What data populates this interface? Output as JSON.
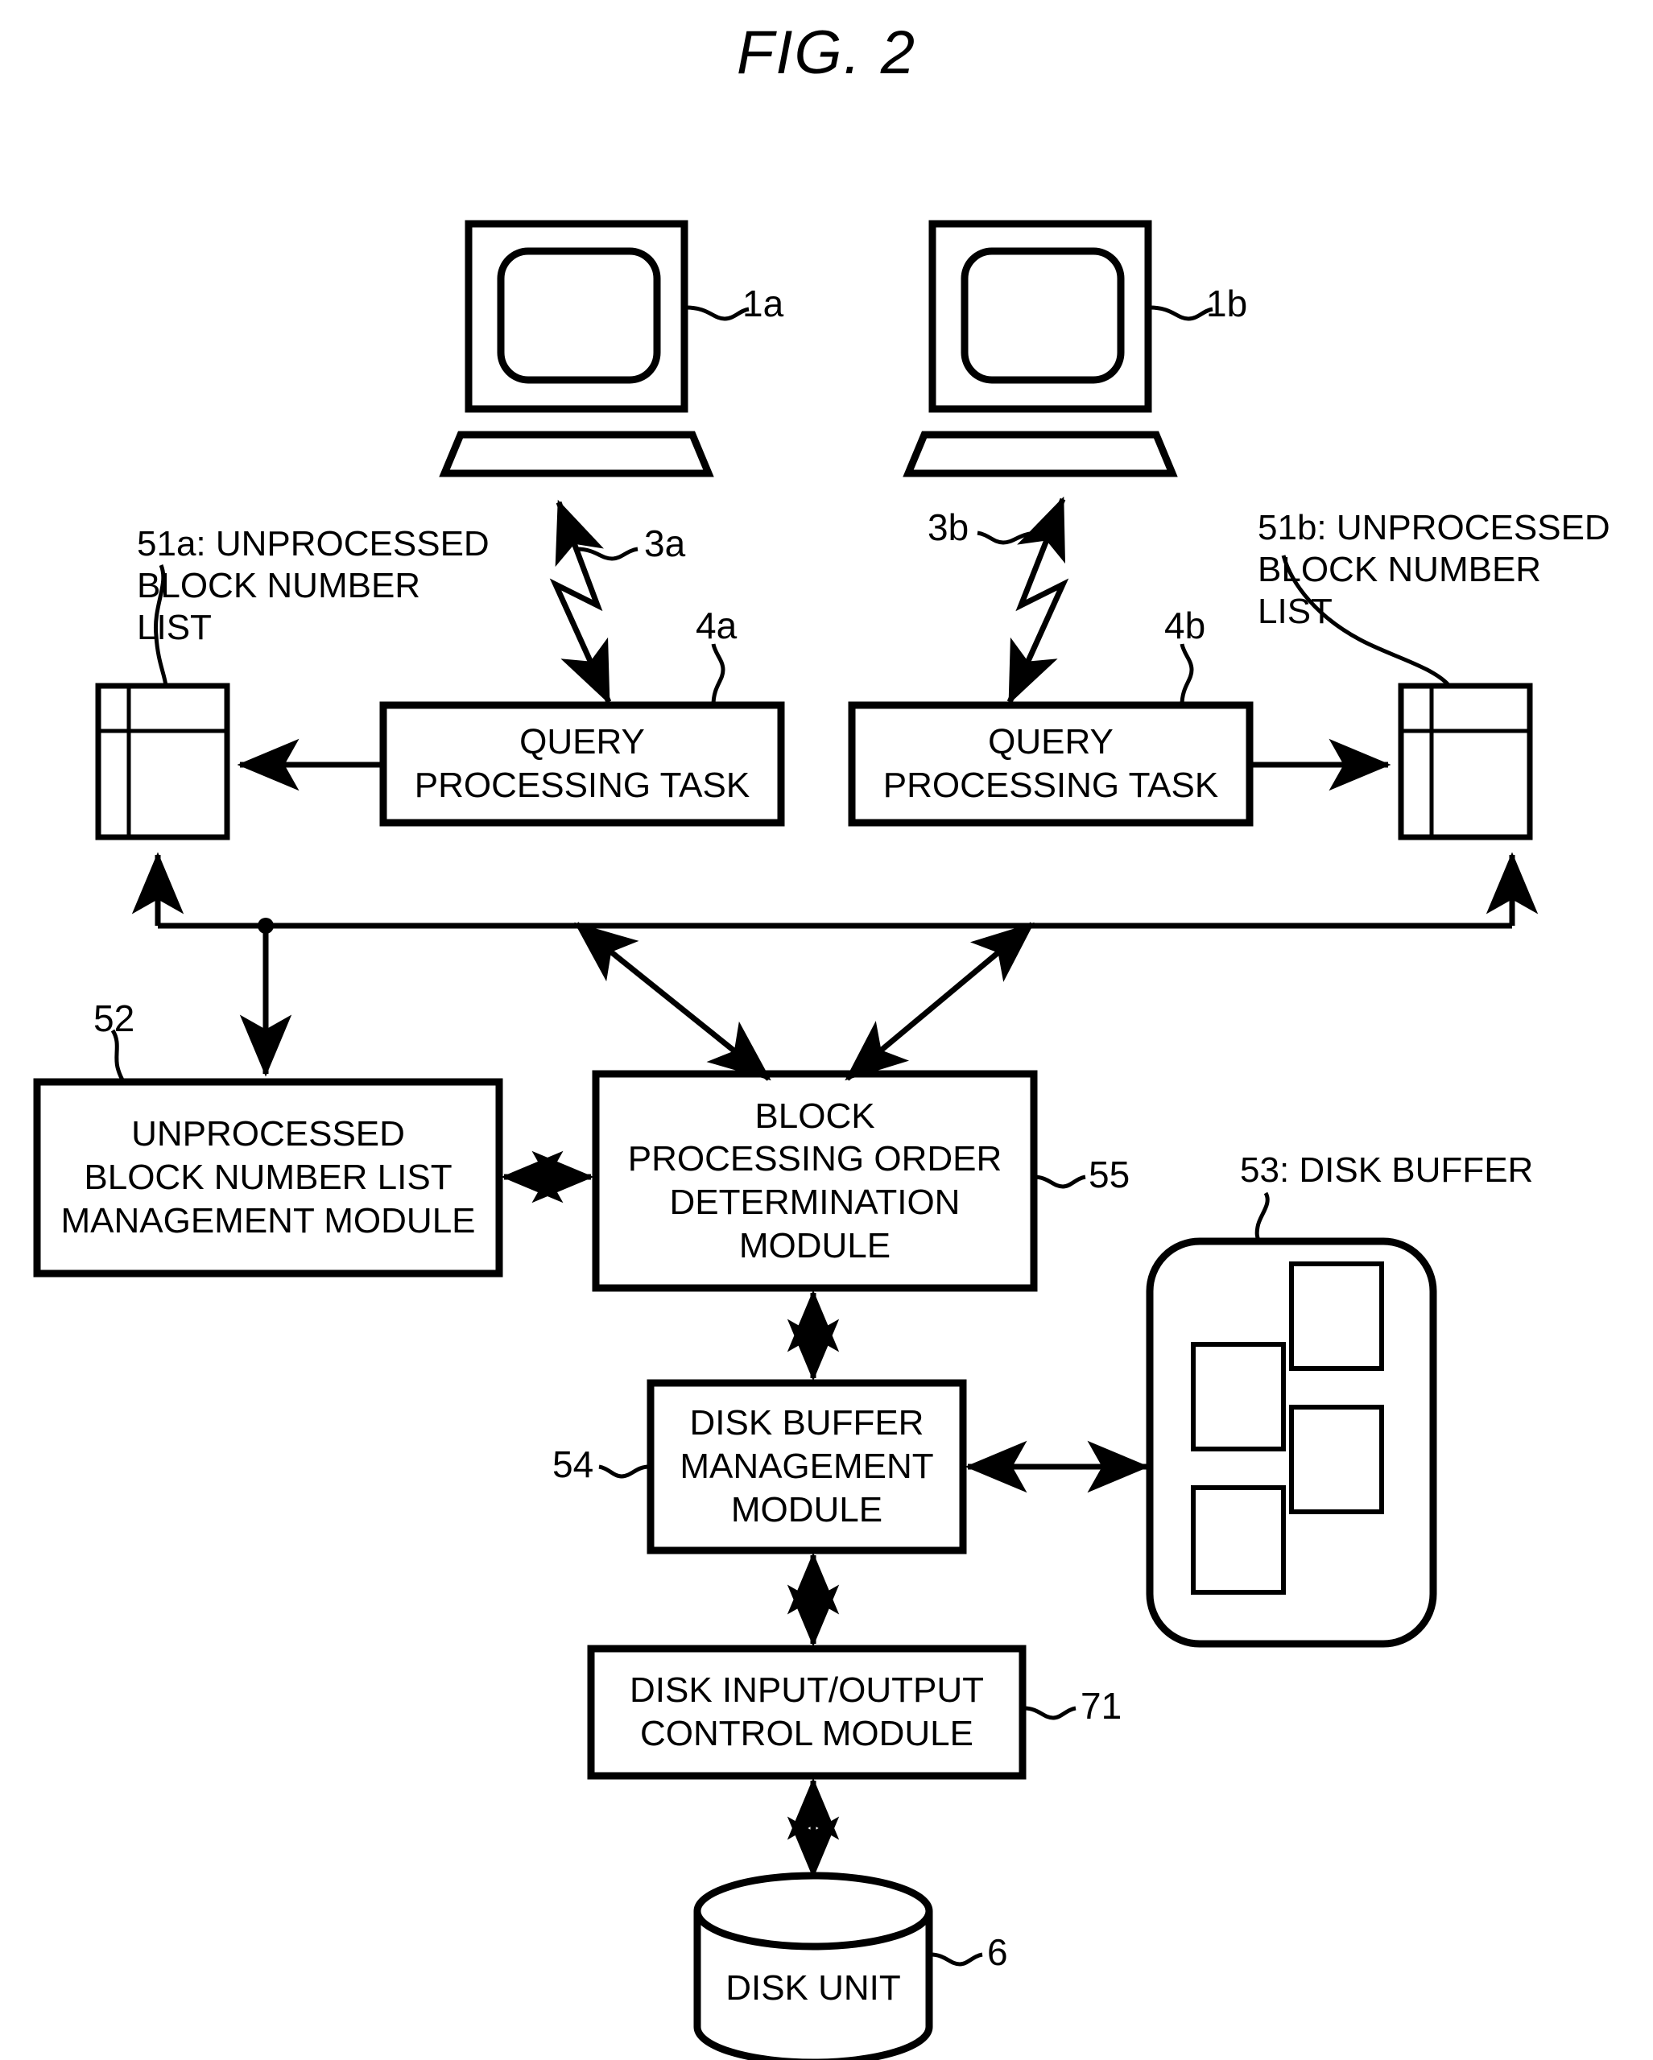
{
  "figure": {
    "title": "FIG. 2"
  },
  "terminals": [
    {
      "ref": "1a",
      "name": "terminal-1a"
    },
    {
      "ref": "1b",
      "name": "terminal-1b"
    }
  ],
  "links": [
    {
      "ref": "3a",
      "name": "link-3a"
    },
    {
      "ref": "3b",
      "name": "link-3b"
    }
  ],
  "tasks": [
    {
      "ref": "4a",
      "label": "QUERY\nPROCESSING TASK"
    },
    {
      "ref": "4b",
      "label": "QUERY\nPROCESSING TASK"
    }
  ],
  "lists": [
    {
      "ref": "51a",
      "label": "51a: UNPROCESSED\nBLOCK NUMBER\nLIST"
    },
    {
      "ref": "51b",
      "label": "51b: UNPROCESSED\nBLOCK NUMBER\nLIST"
    }
  ],
  "modules": {
    "list_management": {
      "ref": "52",
      "label": "UNPROCESSED\nBLOCK NUMBER LIST\nMANAGEMENT MODULE"
    },
    "block_order": {
      "ref": "55",
      "label": "BLOCK\nPROCESSING ORDER\nDETERMINATION\nMODULE"
    },
    "buffer_management": {
      "ref": "54",
      "label": "DISK BUFFER\nMANAGEMENT\nMODULE"
    },
    "disk_io": {
      "ref": "71",
      "label": "DISK INPUT/OUTPUT\nCONTROL MODULE"
    }
  },
  "disk_buffer": {
    "ref": "53",
    "label": "53: DISK BUFFER",
    "cells": 4
  },
  "disk_unit": {
    "ref": "6",
    "label": "DISK UNIT"
  },
  "colors": {
    "line": "#000000",
    "background": "#ffffff"
  }
}
